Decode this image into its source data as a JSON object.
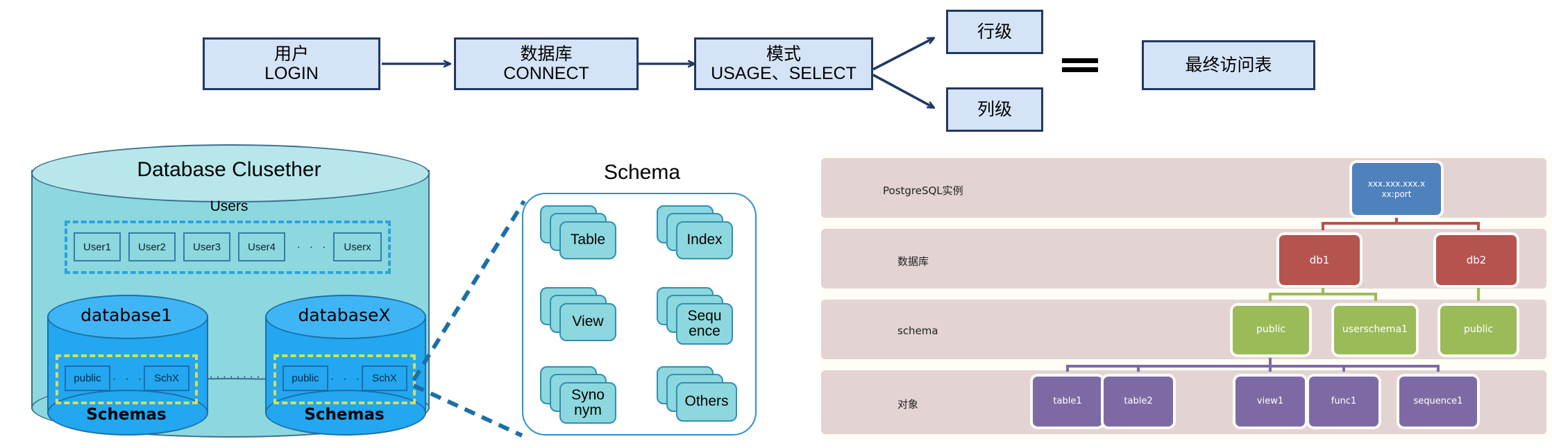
{
  "flow": {
    "steps": [
      {
        "cn": "用户",
        "en": "LOGIN"
      },
      {
        "cn": "数据库",
        "en": "CONNECT"
      },
      {
        "cn": "模式",
        "en": "USAGE、SELECT"
      }
    ],
    "branches": [
      {
        "label": "行级"
      },
      {
        "label": "列级"
      }
    ],
    "result": {
      "label": "最终访问表"
    },
    "equals": "=="
  },
  "cluster": {
    "title": "Database Clusether",
    "title_text": "Database Clusether",
    "users_label": "Users",
    "users": [
      "User1",
      "User2",
      "User3",
      "User4"
    ],
    "users_ellipsis": "· · · · ·",
    "users_last": "Userx",
    "databases": [
      {
        "name": "database1",
        "schemas_label": "Schemas",
        "schemas": [
          "public",
          "SchX"
        ],
        "schema_ellipsis": "· · ·"
      },
      {
        "name": "databaseX",
        "schemas_label": "Schemas",
        "schemas": [
          "public",
          "SchX"
        ],
        "schema_ellipsis": "· · ·"
      }
    ],
    "db_ellipsis": "········"
  },
  "schema_panel": {
    "title": "Schema",
    "items": [
      {
        "label": "Table"
      },
      {
        "label": "Index"
      },
      {
        "label": "View"
      },
      {
        "label": "Sequ\nence",
        "line1": "Sequ",
        "line2": "ence"
      },
      {
        "label": "Syno\nnym",
        "line1": "Syno",
        "line2": "nym"
      },
      {
        "label": "Others"
      }
    ]
  },
  "hierarchy": {
    "rows": [
      {
        "label": "PostgreSQL实例"
      },
      {
        "label": "数据库"
      },
      {
        "label": "schema"
      },
      {
        "label": "对象"
      }
    ],
    "instance": {
      "line1": "xxx.xxx.xxx.x",
      "line2": "xx:port"
    },
    "databases": [
      {
        "label": "db1"
      },
      {
        "label": "db2"
      }
    ],
    "schemas": [
      {
        "label": "public"
      },
      {
        "label": "userschema1"
      },
      {
        "label": "public"
      }
    ],
    "objects": [
      {
        "label": "table1"
      },
      {
        "label": "table2"
      },
      {
        "label": "view1"
      },
      {
        "label": "func1"
      },
      {
        "label": "sequence1"
      }
    ]
  },
  "colors": {
    "flow_fill": "#d5e3f7",
    "flow_border": "#1f3864",
    "cluster_body": "#8cd8de",
    "cluster_top": "#b8e7eb",
    "db_fill": "#22a7f0",
    "users_dash": "#29a3e3",
    "schema_dash": "#d6dd5f",
    "row_band": "#e3d3d3",
    "instance_node": "#4f81bd",
    "db_node": "#b5534f",
    "schema_node": "#9bbb59",
    "object_node": "#7d6aa5"
  }
}
